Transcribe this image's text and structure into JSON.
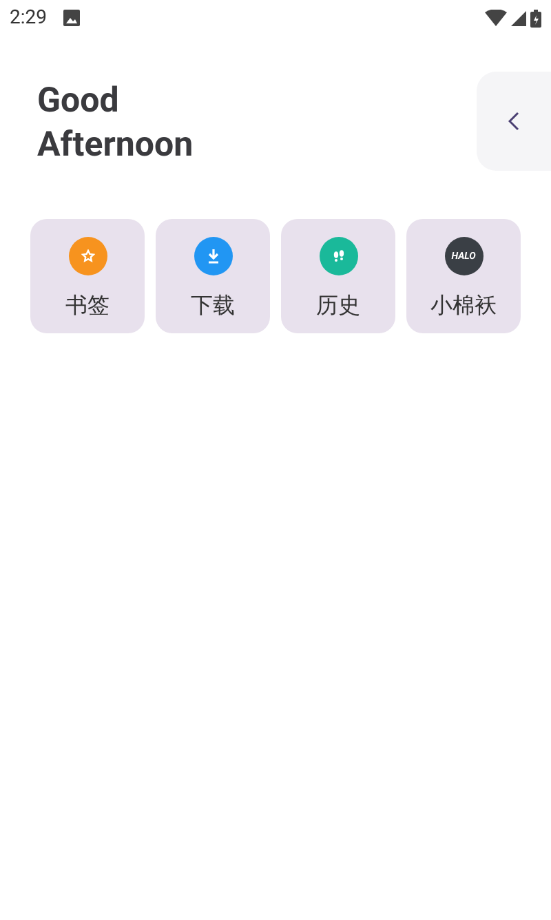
{
  "status_bar": {
    "time": "2:29"
  },
  "greeting": [
    "Good",
    "Afternoon"
  ],
  "shortcuts": [
    {
      "label": "书签",
      "kind": "star",
      "color": "#f7931e"
    },
    {
      "label": "下载",
      "kind": "download",
      "color": "#2196f3"
    },
    {
      "label": "历史",
      "kind": "steps",
      "color": "#1ab99a"
    },
    {
      "label": "小棉袄",
      "kind": "logo",
      "color": "#3a3f45",
      "logo_text": "HALO"
    }
  ]
}
